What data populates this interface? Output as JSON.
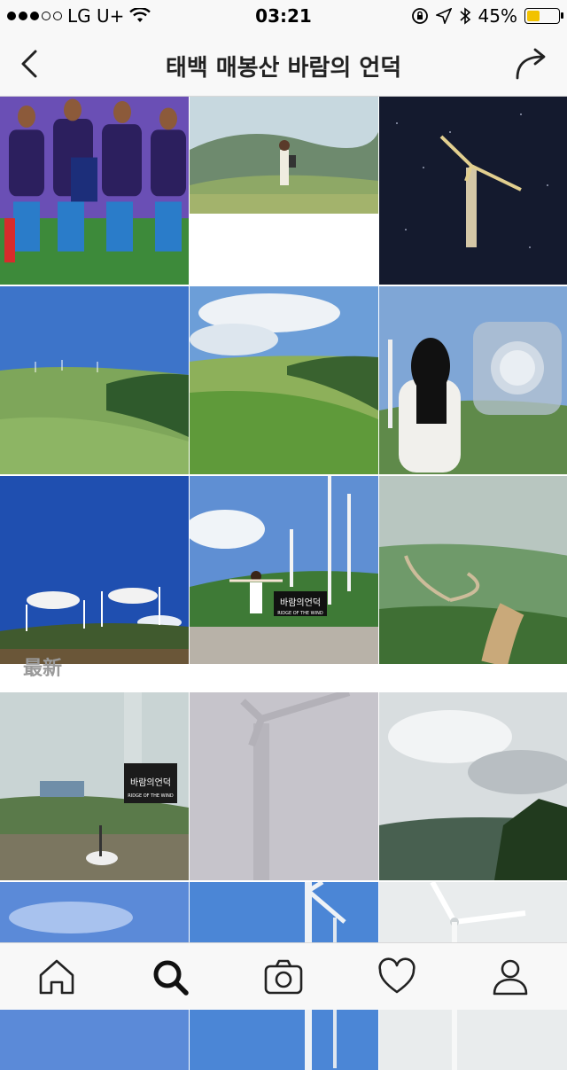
{
  "status_bar": {
    "carrier": "LG U+",
    "time": "03:21",
    "battery": "45%",
    "battery_level": 0.45,
    "signal_dots_filled": 3,
    "signal_dots_total": 5
  },
  "navbar": {
    "title": "태백 매봉산 바람의 언덕",
    "back_icon": "chevron-left-icon",
    "share_icon": "share-arrow-icon"
  },
  "sections": {
    "recent_label": "最新"
  },
  "top_posts": [
    {
      "subject": "soccer-team"
    },
    {
      "subject": "woman-on-hill"
    },
    {
      "subject": "wind-turbine-night"
    },
    {
      "subject": "green-hills-blue-sky"
    },
    {
      "subject": "green-fields-turbines"
    },
    {
      "subject": "woman-back-turbine"
    },
    {
      "subject": "turbines-blue-sky"
    },
    {
      "subject": "woman-arms-open-sign",
      "sign_text": "바람의언덕",
      "sign_subtext": "RIDGE OF THE WIND"
    },
    {
      "subject": "misty-valley-road"
    }
  ],
  "recent_posts": [
    {
      "subject": "foggy-sign-scooter",
      "sign_text": "바람의언덕",
      "sign_subtext": "RIDGE OF THE WIND"
    },
    {
      "subject": "foggy-turbine"
    },
    {
      "subject": "cloudy-mountains"
    },
    {
      "subject": "blue-sky-partial"
    },
    {
      "subject": "turbine-blue-sky-partial"
    },
    {
      "subject": "turbine-white-sky-partial"
    }
  ],
  "tab_bar": [
    {
      "name": "home",
      "icon": "home-icon"
    },
    {
      "name": "search",
      "icon": "search-icon",
      "active": true
    },
    {
      "name": "camera",
      "icon": "camera-icon"
    },
    {
      "name": "activity",
      "icon": "heart-icon"
    },
    {
      "name": "profile",
      "icon": "person-icon"
    }
  ],
  "colors": {
    "bar_background": "#f8f8f8",
    "battery_fill": "#f2c200",
    "section_label": "#9a9a9a"
  }
}
